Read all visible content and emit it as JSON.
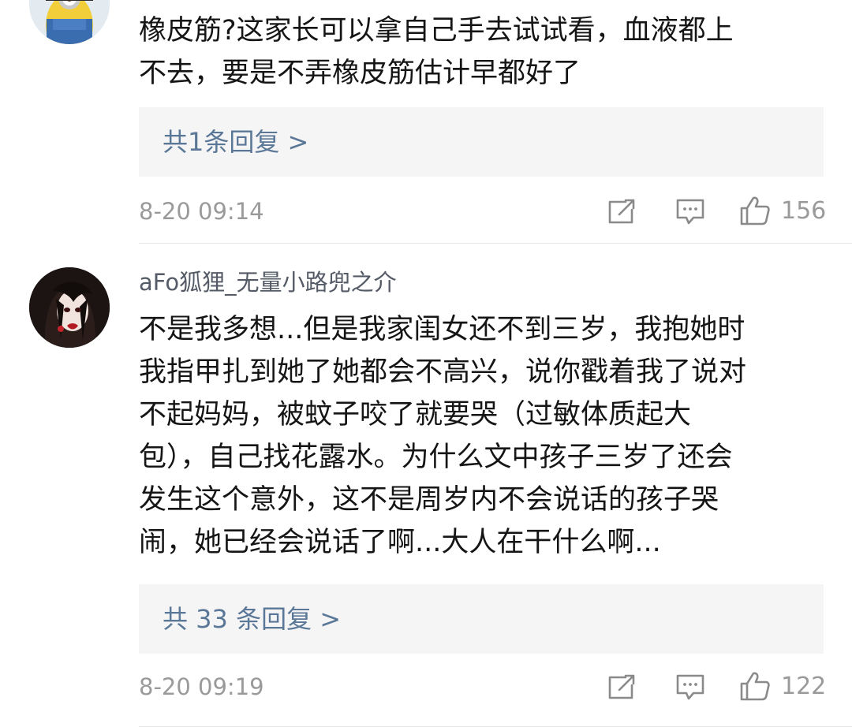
{
  "comments": [
    {
      "username": "",
      "body_lines": [
        "橡皮筋?这家长可以拿自己手去试试看，血液都上",
        "不去，要是不弄橡皮筋估计早都好了"
      ],
      "replies_label": "共1条回复 >",
      "timestamp": "8-20 09:14",
      "like_count": "156",
      "avatar_icon": "minion-avatar-icon"
    },
    {
      "username": "aFo狐狸_无量小路兜之介",
      "body_lines": [
        "不是我多想...但是我家闺女还不到三岁，我抱她时",
        "我指甲扎到她了她都会不高兴，说你戳着我了说对",
        "不起妈妈，被蚊子咬了就要哭（过敏体质起大",
        "包），自己找花露水。为什么文中孩子三岁了还会",
        "发生这个意外，这不是周岁内不会说话的孩子哭",
        "闹，她已经会说话了啊...大人在干什么啊..."
      ],
      "replies_label": "共 33 条回复 >",
      "timestamp": "8-20 09:19",
      "like_count": "122",
      "avatar_icon": "dark-haired-anime-avatar-icon"
    }
  ],
  "icons": {
    "repost": "repost-icon",
    "comment": "comment-icon",
    "like": "thumbs-up-icon"
  },
  "colors": {
    "reply_link": "#5a7797",
    "meta_gray": "#9a9a9a",
    "reply_box_bg": "#f5f5f5"
  }
}
